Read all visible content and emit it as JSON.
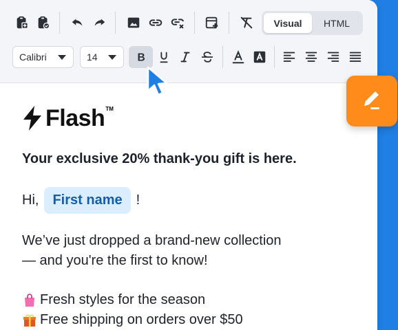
{
  "toolbar": {
    "row1": [
      {
        "icon": "paste-icon"
      },
      {
        "icon": "paste-special-icon"
      },
      {
        "icon": "undo-icon"
      },
      {
        "icon": "redo-icon"
      },
      {
        "icon": "image-icon"
      },
      {
        "icon": "link-icon"
      },
      {
        "icon": "unlink-icon"
      },
      {
        "icon": "insert-block-icon"
      },
      {
        "icon": "clear-format-icon"
      }
    ],
    "mode": {
      "visual_label": "Visual",
      "html_label": "HTML",
      "selected": "Visual"
    },
    "font_family": "Calibri",
    "font_size": "14",
    "format": {
      "bold_active": true,
      "icons": [
        "bold-icon",
        "underline-icon",
        "italic-icon",
        "strikethrough-icon",
        "text-color-icon",
        "highlight-icon",
        "align-left-icon",
        "align-center-icon",
        "align-right-icon",
        "align-justify-icon"
      ]
    }
  },
  "email": {
    "brand": "Flash",
    "brand_tm": "TM",
    "headline": "Your exclusive 20% thank-you gift is here.",
    "greeting_prefix": "Hi,",
    "merge_tag": "First name",
    "greeting_suffix": "!",
    "paragraph_line1": "We’ve just dropped a brand-new collection",
    "paragraph_line2": "— and you're the first to know!",
    "bullets": [
      {
        "icon": "shopping-bag-icon",
        "text": "Fresh styles for the season"
      },
      {
        "icon": "gift-icon",
        "text": "Free shipping on orders over $50"
      }
    ]
  },
  "colors": {
    "accent_blue": "#1f7fe5",
    "fab_orange": "#ff8c1a",
    "merge_tag_bg": "#dbeeff",
    "merge_tag_text": "#125ea8"
  },
  "fab": {
    "icon": "edit-pen-icon"
  }
}
